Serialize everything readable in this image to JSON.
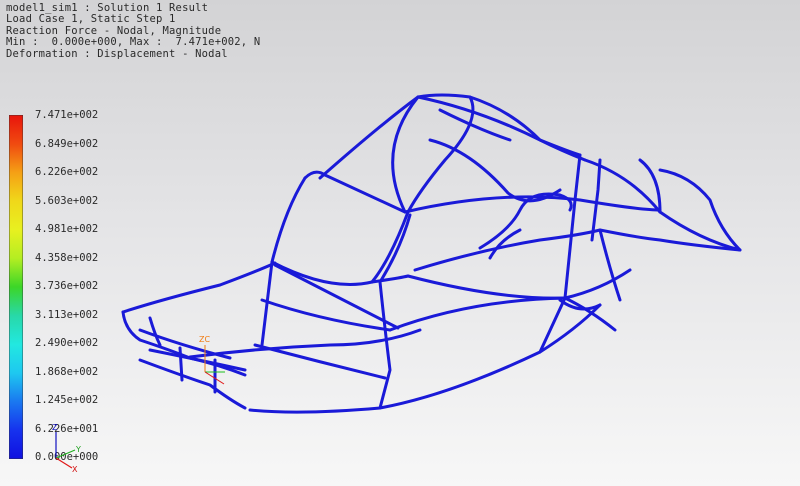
{
  "header": {
    "lines": [
      "model1_sim1 : Solution 1 Result",
      "Load Case 1, Static Step 1",
      "Reaction Force - Nodal, Magnitude",
      "Min :  0.000e+000, Max :  7.471e+002, N",
      "Deformation : Displacement - Nodal"
    ]
  },
  "legend": {
    "labels": [
      "7.471e+002",
      "6.849e+002",
      "6.226e+002",
      "5.603e+002",
      "4.981e+002",
      "4.358e+002",
      "3.736e+002",
      "3.113e+002",
      "2.490e+002",
      "1.868e+002",
      "1.245e+002",
      "6.226e+001",
      "0.000e+000"
    ],
    "colors": [
      "#e8140c",
      "#f04a10",
      "#f5a015",
      "#f0d81a",
      "#e8f020",
      "#b4ee22",
      "#3cd628",
      "#28d8a8",
      "#22e8e0",
      "#1ec8f0",
      "#1a78f0",
      "#1632ee",
      "#1010e0"
    ]
  },
  "model": {
    "color": "#1a1ad8",
    "triad_labels": {
      "model_z": "ZC",
      "view_x": "X",
      "view_y": "Y",
      "view_z": "Z"
    }
  }
}
